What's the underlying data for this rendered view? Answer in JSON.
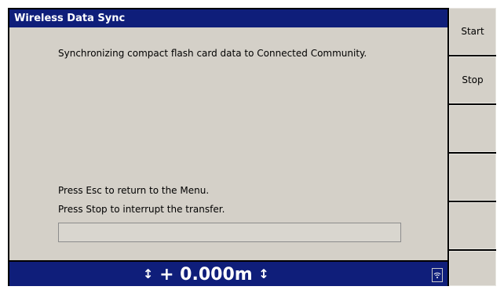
{
  "window": {
    "title": "Wireless Data Sync"
  },
  "messages": {
    "sync_status": "Synchronizing compact flash card data to Connected Community.",
    "esc_hint": "Press Esc to return to the Menu.",
    "stop_hint": "Press Stop to interrupt the transfer."
  },
  "progress": {
    "fraction": 0
  },
  "status_bar": {
    "arrow_left": "↕",
    "elevation": "+ 0.000m",
    "arrow_right": "↕",
    "icon": "wireless-signal-icon"
  },
  "side_buttons": [
    {
      "label": "Start"
    },
    {
      "label": "Stop"
    },
    {
      "label": ""
    },
    {
      "label": ""
    },
    {
      "label": ""
    },
    {
      "label": ""
    }
  ],
  "colors": {
    "titlebar": "#0f1e7a",
    "panel": "#d4d0c8",
    "frame": "#000000"
  }
}
